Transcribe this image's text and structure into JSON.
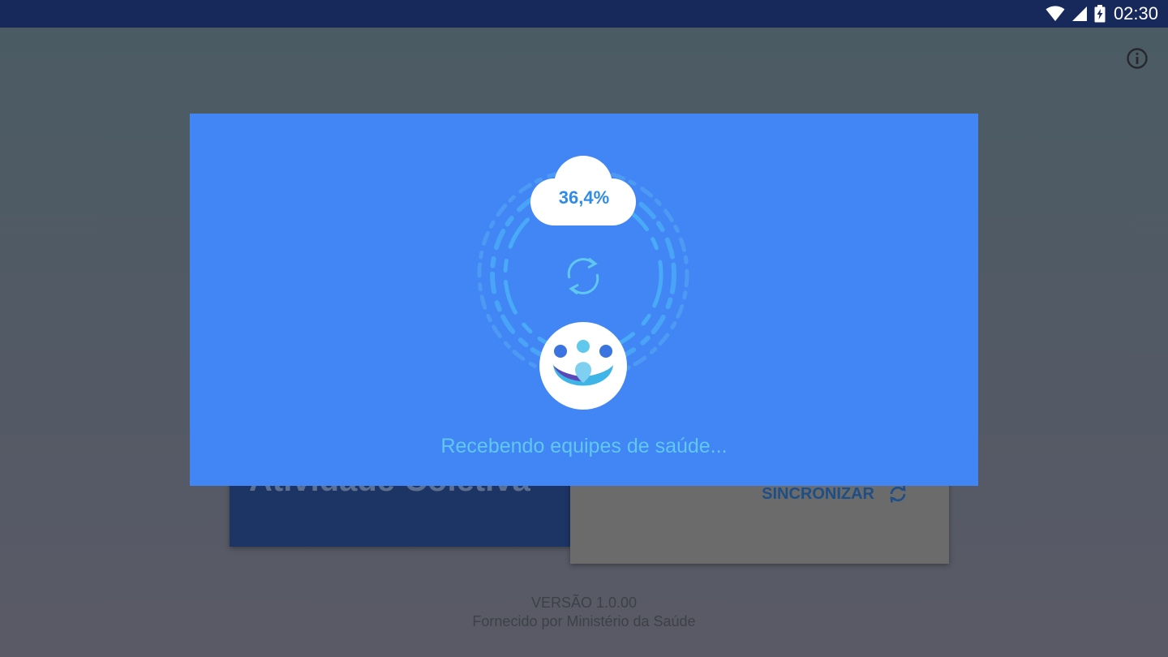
{
  "status_bar": {
    "time": "02:30",
    "icons": [
      "wifi-icon",
      "signal-icon",
      "battery-charging-icon"
    ]
  },
  "toolbar": {
    "info_icon": "info-icon"
  },
  "background_screen": {
    "card_title": "Atividade Coletiva",
    "sync_label": "SINCRONIZAR",
    "sync_icon": "sync-icon",
    "version": "VERSÃO 1.0.00",
    "provider": "Fornecido por Ministério da Saúde"
  },
  "sync_dialog": {
    "progress_text": "36,4%",
    "progress_value": 36.4,
    "status_message": "Recebendo equipes de saúde...",
    "icons": [
      "cloud-icon",
      "sync-icon",
      "app-logo"
    ]
  },
  "colors": {
    "status_bar": "#17295a",
    "dialog_background": "#4285f4",
    "progress_text": "#2f8ce6",
    "message_text": "#5fc8ec"
  }
}
